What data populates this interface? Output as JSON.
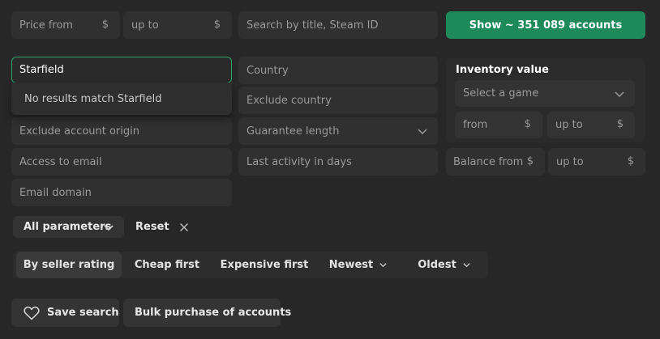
{
  "top_bar": {
    "price_from_placeholder": "Price from",
    "price_to_placeholder": "up to",
    "currency_symbol": "$",
    "search_placeholder": "Search by title, Steam ID",
    "show_button_label": "Show ~ 351 089 accounts"
  },
  "game_search": {
    "value": "Starfield",
    "no_results_text": "No results match Starfield"
  },
  "filters": {
    "exclude_account_origin": "Exclude account origin",
    "access_to_email": "Access to email",
    "email_domain": "Email domain",
    "country": "Country",
    "exclude_country": "Exclude country",
    "guarantee_length": "Guarantee length",
    "last_activity": "Last activity in days"
  },
  "inventory": {
    "title": "Inventory value",
    "select_game": "Select a game",
    "from_placeholder": "from",
    "to_placeholder": "up to",
    "currency_symbol": "$"
  },
  "balance": {
    "from_placeholder": "Balance from",
    "to_placeholder": "up to",
    "currency_symbol": "$"
  },
  "parameters": {
    "all_parameters_label": "All parameters",
    "reset_label": "Reset"
  },
  "sort": {
    "by_seller_rating": "By seller rating",
    "cheap_first": "Cheap first",
    "expensive_first": "Expensive first",
    "newest": "Newest",
    "oldest": "Oldest"
  },
  "actions": {
    "save_search": "Save search",
    "bulk_purchase": "Bulk purchase of accounts"
  },
  "colors": {
    "accent_green": "#1e8a5a",
    "focus_border": "#2fa068",
    "background": "#272727"
  }
}
